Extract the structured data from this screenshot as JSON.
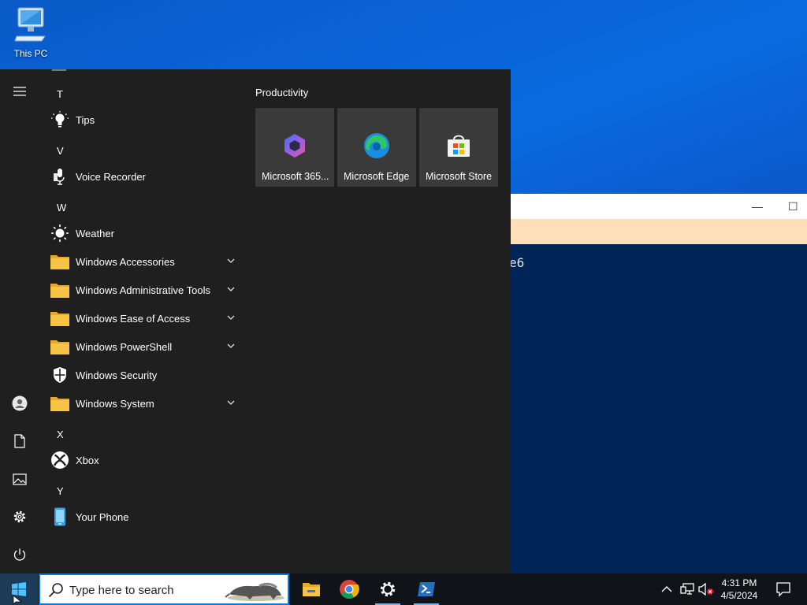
{
  "desktop": {
    "icons": [
      {
        "label": "This PC",
        "icon": "computer-icon"
      }
    ]
  },
  "background_window": {
    "snippet": "e6",
    "controls": {
      "minimize": "—",
      "maximize": "☐"
    }
  },
  "start_menu": {
    "rail": [
      "hamburger-menu-icon",
      "user-icon",
      "documents-icon",
      "pictures-icon",
      "settings-icon",
      "power-icon"
    ],
    "letters": {
      "t": "T",
      "v": "V",
      "w": "W",
      "x": "X",
      "y": "Y"
    },
    "apps": {
      "tips": "Tips",
      "voice_recorder": "Voice Recorder",
      "weather": "Weather",
      "win_accessories": "Windows Accessories",
      "win_admin_tools": "Windows Administrative Tools",
      "win_ease": "Windows Ease of Access",
      "win_powershell": "Windows PowerShell",
      "win_security": "Windows Security",
      "win_system": "Windows System",
      "xbox": "Xbox",
      "your_phone": "Your Phone"
    },
    "tiles_group": "Productivity",
    "tiles": {
      "m365": "Microsoft 365...",
      "edge": "Microsoft Edge",
      "store": "Microsoft Store"
    }
  },
  "taskbar": {
    "search_placeholder": "Type here to search",
    "pinned": [
      "file-explorer-icon",
      "chrome-icon",
      "settings-icon",
      "powershell-icon"
    ],
    "clock": {
      "time": "4:31 PM",
      "date": "4/5/2024"
    }
  },
  "colors": {
    "accent": "#0a78d7",
    "folder": "#f6c543",
    "menu_bg": "#1f1f1f",
    "tile_bg": "#3a3a3a",
    "taskbar_bg": "#101318"
  }
}
